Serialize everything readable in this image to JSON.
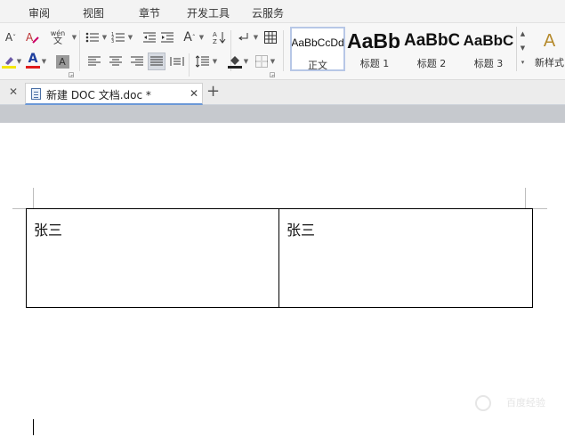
{
  "menu": [
    "审阅",
    "视图",
    "章节",
    "开发工具",
    "云服务"
  ],
  "toolbar": {
    "font_shrink": "A",
    "clear_format": "A",
    "phonetic": "wén",
    "phonetic_sub": "文",
    "font_color": "A",
    "char_shade": "A",
    "grow_font": "A",
    "sort_label": "A Z"
  },
  "styles": [
    {
      "preview": "AaBbCcDd",
      "name": "正文"
    },
    {
      "preview": "AaBb",
      "name": "标题 1"
    },
    {
      "preview": "AaBbC",
      "name": "标题 2"
    },
    {
      "preview": "AaBbC",
      "name": "标题 3"
    }
  ],
  "new_style": {
    "preview": "A",
    "name": "新样式"
  },
  "tab": {
    "title": "新建 DOC 文档.doc *"
  },
  "table": {
    "rows": [
      [
        "张三",
        "张三"
      ]
    ]
  },
  "watermark": "百度经验"
}
